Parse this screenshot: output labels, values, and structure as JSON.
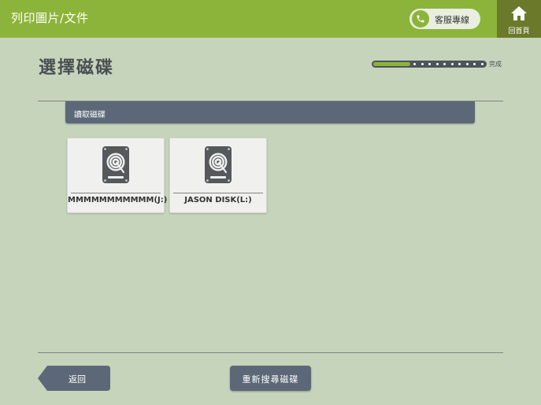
{
  "header": {
    "title": "列印圖片/文件",
    "hotline_label": "客服專線",
    "home_label": "回首頁"
  },
  "page": {
    "title": "選擇磁碟",
    "progress_label": "完成",
    "progress_fraction": 0.33
  },
  "section": {
    "label": "讀取磁碟"
  },
  "disks": [
    {
      "label": "MMMMMMMMMMM(J:)",
      "icon": "hard-disk-icon"
    },
    {
      "label": "JASON DISK(L:)",
      "icon": "hard-disk-icon"
    }
  ],
  "footer": {
    "back_label": "返回",
    "rescan_label": "重新搜尋磁碟"
  },
  "colors": {
    "background": "#c6d4bc",
    "header": "#8db43a",
    "home_button": "#6a7a2a",
    "slate_button": "#5c6878",
    "progress_track": "#4d545a"
  }
}
